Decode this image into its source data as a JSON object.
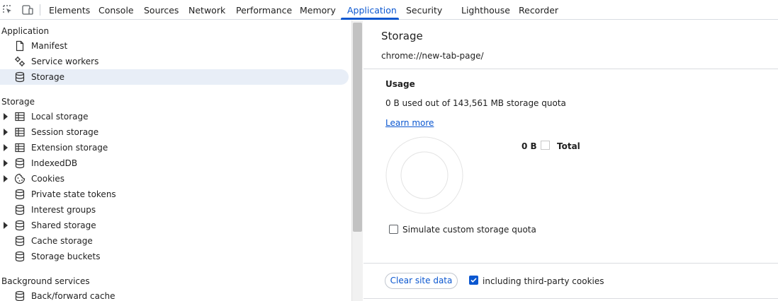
{
  "toolbar": {
    "tabs": [
      {
        "label": "Elements"
      },
      {
        "label": "Console"
      },
      {
        "label": "Sources"
      },
      {
        "label": "Network"
      },
      {
        "label": "Performance"
      },
      {
        "label": "Memory"
      },
      {
        "label": "Application"
      },
      {
        "label": "Security"
      },
      {
        "label": "Lighthouse"
      },
      {
        "label": "Recorder"
      }
    ],
    "active_tab": "Application",
    "accent_color": "#0b57d0",
    "icons": [
      "inspect-element-icon",
      "device-toolbar-icon"
    ]
  },
  "sidebar": {
    "sections": [
      {
        "heading": "Application",
        "items": [
          {
            "label": "Manifest",
            "icon": "document-icon",
            "expandable": false
          },
          {
            "label": "Service workers",
            "icon": "gears-icon",
            "expandable": false
          },
          {
            "label": "Storage",
            "icon": "database-icon",
            "expandable": false,
            "selected": true
          }
        ]
      },
      {
        "heading": "Storage",
        "items": [
          {
            "label": "Local storage",
            "icon": "table-icon",
            "expandable": true
          },
          {
            "label": "Session storage",
            "icon": "table-icon",
            "expandable": true
          },
          {
            "label": "Extension storage",
            "icon": "table-icon",
            "expandable": true
          },
          {
            "label": "IndexedDB",
            "icon": "database-icon",
            "expandable": true
          },
          {
            "label": "Cookies",
            "icon": "cookie-icon",
            "expandable": true
          },
          {
            "label": "Private state tokens",
            "icon": "database-icon",
            "expandable": false
          },
          {
            "label": "Interest groups",
            "icon": "database-icon",
            "expandable": false
          },
          {
            "label": "Shared storage",
            "icon": "database-icon",
            "expandable": true
          },
          {
            "label": "Cache storage",
            "icon": "database-icon",
            "expandable": false
          },
          {
            "label": "Storage buckets",
            "icon": "database-icon",
            "expandable": false
          }
        ]
      },
      {
        "heading": "Background services",
        "items": [
          {
            "label": "Back/forward cache",
            "icon": "database-icon",
            "expandable": false
          }
        ]
      }
    ]
  },
  "main": {
    "title": "Storage",
    "origin": "chrome://new-tab-page/",
    "usage": {
      "heading": "Usage",
      "text": "0 B used out of 143,561 MB storage quota",
      "learn_more": "Learn more",
      "legend_value": "0 B",
      "legend_label": "Total",
      "simulate_label": "Simulate custom storage quota",
      "simulate_checked": false
    },
    "clear_button": "Clear site data",
    "third_party_label": "including third-party cookies",
    "third_party_checked": true
  }
}
